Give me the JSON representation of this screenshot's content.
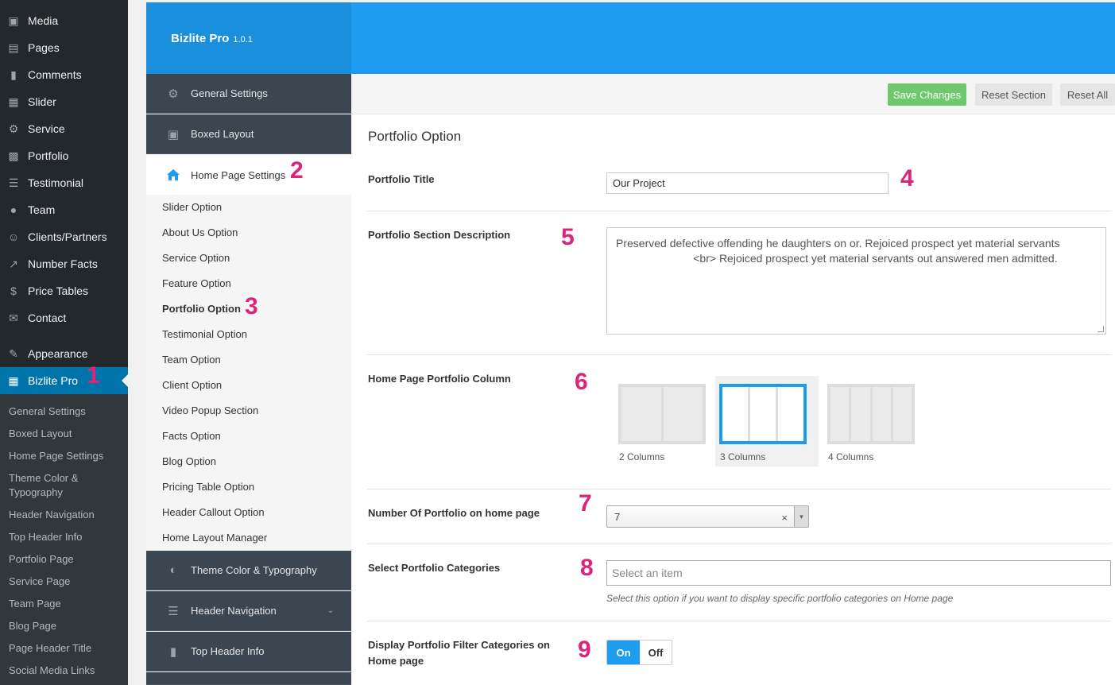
{
  "wp_menu": [
    {
      "label": "Media",
      "icon": "media-icon"
    },
    {
      "label": "Pages",
      "icon": "pages-icon"
    },
    {
      "label": "Comments",
      "icon": "comments-icon"
    },
    {
      "label": "Slider",
      "icon": "slider-icon"
    },
    {
      "label": "Service",
      "icon": "gear-icon"
    },
    {
      "label": "Portfolio",
      "icon": "portfolio-icon"
    },
    {
      "label": "Testimonial",
      "icon": "list-icon"
    },
    {
      "label": "Team",
      "icon": "team-icon"
    },
    {
      "label": "Clients/Partners",
      "icon": "user-icon"
    },
    {
      "label": "Number Facts",
      "icon": "chart-icon"
    },
    {
      "label": "Price Tables",
      "icon": "dollar-icon"
    },
    {
      "label": "Contact",
      "icon": "mail-icon"
    },
    {
      "label": "Appearance",
      "icon": "brush-icon"
    },
    {
      "label": "Bizlite Pro",
      "icon": "table-icon"
    }
  ],
  "wp_submenu": [
    "General Settings",
    "Boxed Layout",
    "Home Page Settings",
    "Theme Color & Typography",
    "Header Navigation",
    "Top Header Info",
    "Portfolio Page",
    "Service Page",
    "Team Page",
    "Blog Page",
    "Page Header Title",
    "Social Media Links"
  ],
  "markers": [
    "1",
    "2",
    "3",
    "4",
    "5",
    "6",
    "7",
    "8",
    "9"
  ],
  "brand": {
    "name": "Bizlite Pro",
    "version": "1.0.1"
  },
  "rs_sections": {
    "general": "General Settings",
    "boxed": "Boxed Layout",
    "home": "Home Page Settings",
    "theme": "Theme Color & Typography",
    "header_nav": "Header Navigation",
    "top_header": "Top Header Info"
  },
  "rs_subitems": [
    "Slider Option",
    "About Us Option",
    "Service Option",
    "Feature Option",
    "Portfolio Option",
    "Testimonial Option",
    "Team Option",
    "Client Option",
    "Video Popup Section",
    "Facts Option",
    "Blog Option",
    "Pricing Table Option",
    "Header Callout Option",
    "Home Layout Manager"
  ],
  "toolbar": {
    "save": "Save Changes",
    "reset_section": "Reset Section",
    "reset_all": "Reset All"
  },
  "section_title": "Portfolio Option",
  "fields": {
    "title_label": "Portfolio Title",
    "title_value": "Our Project",
    "desc_label": "Portfolio Section Description",
    "desc_value": "Preserved defective offending he daughters on or. Rejoiced prospect yet material servants\n                         <br> Rejoiced prospect yet material servants out answered men admitted.",
    "column_label": "Home Page Portfolio Column",
    "column_options": [
      "2 Columns",
      "3 Columns",
      "4 Columns"
    ],
    "column_selected": "3 Columns",
    "number_label": "Number Of Portfolio on home page",
    "number_value": "7",
    "categories_label": "Select Portfolio Categories",
    "categories_placeholder": "Select an item",
    "categories_hint": "Select this option if you want to display specific portfolio categories on Home page",
    "filter_label_1": "Display Portfolio Filter Categories on",
    "filter_label_2": "Home page",
    "filter_on": "On",
    "filter_off": "Off"
  },
  "colors": {
    "accent": "#1e9cf0",
    "save": "#6ec96e",
    "marker": "#e0237a",
    "wp_dark": "#23282d",
    "wp_active": "#0073aa"
  }
}
